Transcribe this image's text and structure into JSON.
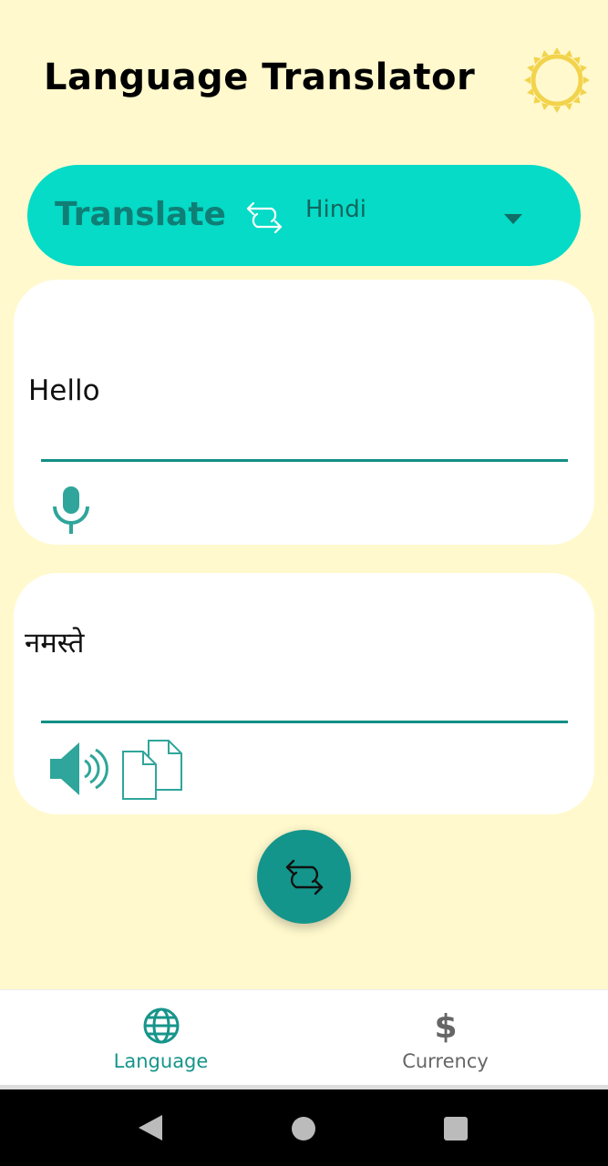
{
  "header": {
    "title": "Language Translator",
    "theme_icon": "sun-icon"
  },
  "translate_bar": {
    "label": "Translate",
    "swap_icon": "swap-icon",
    "selected_language": "Hindi",
    "dropdown_icon": "chevron-down-icon"
  },
  "input_card": {
    "text": "Hello",
    "mic_icon": "microphone-icon"
  },
  "output_card": {
    "text": "नमस्ते",
    "speaker_icon": "speaker-icon",
    "copy_icon": "copy-icon"
  },
  "fab": {
    "icon": "swap-icon"
  },
  "bottom_nav": {
    "items": [
      {
        "label": "Language",
        "icon": "globe-icon",
        "active": true
      },
      {
        "label": "Currency",
        "icon": "dollar-icon",
        "active": false
      }
    ]
  },
  "system_nav": {
    "back": "back-icon",
    "home": "home-icon",
    "recents": "recents-icon"
  },
  "colors": {
    "background": "#fff9cd",
    "accent": "#05dbc6",
    "primary": "#14958b"
  }
}
